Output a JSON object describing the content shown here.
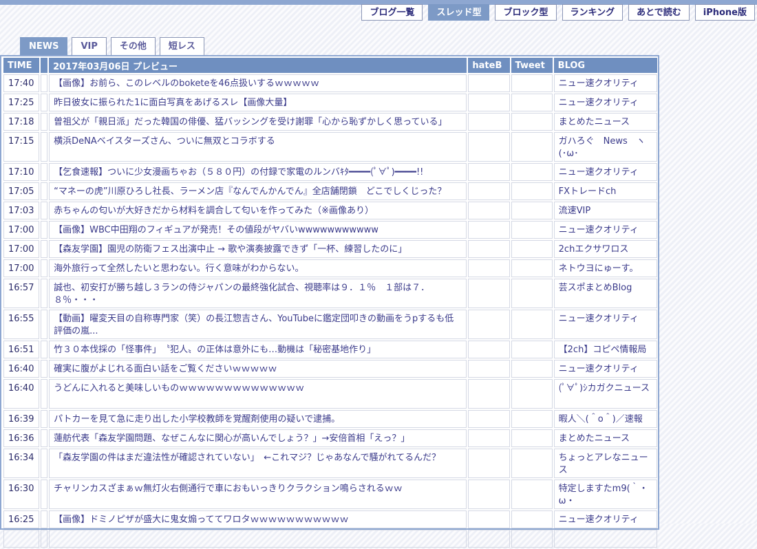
{
  "top_nav": [
    {
      "label": "ブログ一覧",
      "active": false
    },
    {
      "label": "スレッド型",
      "active": true
    },
    {
      "label": "ブロック型",
      "active": false
    },
    {
      "label": "ランキング",
      "active": false
    },
    {
      "label": "あとで読む",
      "active": false
    },
    {
      "label": "iPhone版",
      "active": false
    }
  ],
  "tabs": [
    {
      "label": "NEWS",
      "active": true
    },
    {
      "label": "VIP",
      "active": false
    },
    {
      "label": "その他",
      "active": false
    },
    {
      "label": "短レス",
      "active": false
    }
  ],
  "table": {
    "headers": {
      "time": "TIME",
      "marker": "",
      "title": "2017年03月06日 プレビュー",
      "hateb": "hateB",
      "tweet": "Tweet",
      "blog": "BLOG"
    },
    "rows": [
      {
        "time": "17:40",
        "title": "【画像】お前ら、このレベルのboketeを46点扱いするｗｗｗｗｗ",
        "blog": "ニュー速クオリティ",
        "tall": false
      },
      {
        "time": "17:25",
        "title": "昨日彼女に振られた1に面白写真をあげるスレ【画像大量】",
        "blog": "ニュー速クオリティ",
        "tall": false
      },
      {
        "time": "17:18",
        "title": "曽祖父が「親日派」だった韓国の俳優、猛バッシングを受け謝罪「心から恥ずかしく思っている」",
        "blog": "まとめたニュース",
        "tall": false
      },
      {
        "time": "17:15",
        "title": "横浜DeNAベイスターズさん、ついに無双とコラボする",
        "blog": "ガハろぐ　News　ヽ(･ω･",
        "tall": true
      },
      {
        "time": "17:10",
        "title": "【乞食速報】ついに少女漫画ちゃお（５８０円）の付録で家電のルンバｷﾀ━━━━(ﾟ∀ﾟ)━━━━!!",
        "blog": "ニュー速クオリティ",
        "tall": false
      },
      {
        "time": "17:05",
        "title": "“マネーの虎”川原ひろし社長、ラーメン店『なんでんかんでん』全店舗閉鎖　どこでしくじった？",
        "blog": "FXトレードch",
        "tall": false
      },
      {
        "time": "17:03",
        "title": "赤ちゃんの匂いが大好きだから材料を調合して匂いを作ってみた（※画像あり）",
        "blog": "流速VIP",
        "tall": false
      },
      {
        "time": "17:00",
        "title": "【画像】WBC中田翔のフィギュアが発売！その値段がヤバいwwwwwwwwwww",
        "blog": "ニュー速クオリティ",
        "tall": false
      },
      {
        "time": "17:00",
        "title": "【森友学園】園児の防衛フェス出演中止 → 歌や演奏披露できず「一杯、練習したのに」",
        "blog": "2chエクサワロス",
        "tall": false
      },
      {
        "time": "17:00",
        "title": "海外旅行って全然したいと思わない。行く意味がわからない。",
        "blog": "ネトウヨにゅーす。",
        "tall": false
      },
      {
        "time": "16:57",
        "title": "誠也、初安打が勝ち越し３ランの侍ジャパンの最終強化試合、視聴率は９．１％　１部は７．８％・・・",
        "blog": "芸スポまとめBlog",
        "tall": true
      },
      {
        "time": "16:55",
        "title": "【動画】曜変天目の自称専門家（笑）の長江惣吉さん、YouTubeに鑑定団叩きの動画をうpするも低評価の嵐...",
        "blog": "ニュー速クオリティ",
        "tall": true
      },
      {
        "time": "16:51",
        "title": "竹３０本伐採の「怪事件」　〝犯人〟の正体は意外にも…動機は「秘密基地作り」",
        "blog": "【2ch】コピペ情報局",
        "tall": false
      },
      {
        "time": "16:40",
        "title": "確実に腹がよじれる面白い話をご覧くださいｗｗｗｗｗ",
        "blog": "ニュー速クオリティ",
        "tall": false
      },
      {
        "time": "16:40",
        "title": "うどんに入れると美味しいものｗｗｗｗｗｗｗｗｗｗｗｗｗｗ",
        "blog": "(ﾟ∀ﾟ)ｼカガクニュース",
        "tall": true
      },
      {
        "time": "16:39",
        "title": "パトカーを見て急に走り出した小学校教師を覚醒剤使用の疑いで逮捕。",
        "blog": "暇人＼(＾o＾)／速報",
        "tall": false
      },
      {
        "time": "16:36",
        "title": "蓮舫代表「森友学園問題、なぜこんなに関心が高いんでしょう？」→安倍首相「えっ？」",
        "blog": "まとめたニュース",
        "tall": false
      },
      {
        "time": "16:34",
        "title": "「森友学園の件はまだ違法性が確認されていない」　←これマジ？じゃあなんで騒がれてるんだ？",
        "blog": "ちょっとアレなニュース",
        "tall": true
      },
      {
        "time": "16:30",
        "title": "チャリンカスざまぁｗ無灯火右側通行で車におもいっきりクラクション鳴らされるｗｗ",
        "blog": "特定しますたm9(｀・ω・",
        "tall": true
      },
      {
        "time": "16:25",
        "title": "【画像】ドミノピザが盛大に鬼女煽っててワロタｗｗｗｗｗｗｗｗｗｗｗ",
        "blog": "ニュー速クオリティ",
        "tall": false
      },
      {
        "time": "",
        "title": "",
        "blog": "",
        "tall": false
      }
    ]
  }
}
